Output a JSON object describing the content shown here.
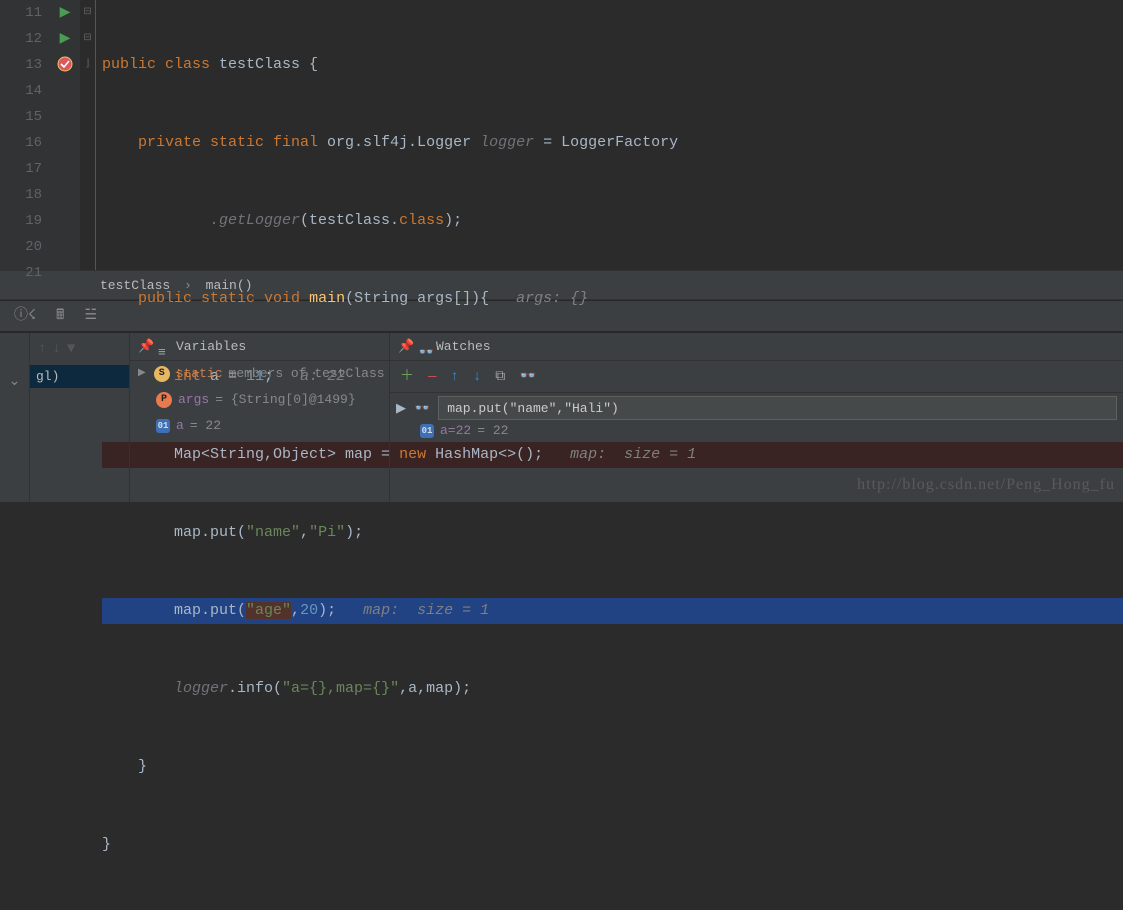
{
  "gutter": [
    "11",
    "12",
    "13",
    "14",
    "15",
    "16",
    "17",
    "18",
    "19",
    "20",
    "21"
  ],
  "code": {
    "l11_kw1": "public ",
    "l11_kw2": "class ",
    "l11_id": "testClass",
    "l11_b": " {",
    "l12_kw": "private static final ",
    "l12_t": "org.slf4j.Logger ",
    "l12_v": "logger",
    "l12_eq": " = ",
    "l12_m": "LoggerFactory",
    "l13_m": ".getLogger",
    "l13_r": "(testClass.",
    "l13_kw": "class",
    "l13_e": ");",
    "l14_kw1": "public static ",
    "l14_kw2": "void ",
    "l14_m": "main",
    "l14_p": "(String args[]){",
    "l14_h": "   args: {}",
    "l15_kw": "int ",
    "l15_v": "a = ",
    "l15_n": "11",
    "l15_s": ";",
    "l15_h": "   a: 22",
    "l16_t": "Map<String,Object> map = ",
    "l16_kw": "new ",
    "l16_c": "HashMap<>()",
    "l16_s": ";",
    "l16_h": "   map:  size = 1",
    "l17_a": "map.put(",
    "l17_s1": "\"name\"",
    "l17_b": ",",
    "l17_s2": "\"Pi\"",
    "l17_c": ");",
    "l18_a": "map.put(",
    "l18_s1": "\"age\"",
    "l18_b": ",",
    "l18_n": "20",
    "l18_c": ");",
    "l18_h": "   map:  size = 1",
    "l19_v": "logger",
    "l19_m": ".info(",
    "l19_s": "\"a={},map={}\"",
    "l19_r": ",a,map);",
    "l20_b": "}",
    "l21_b": "}"
  },
  "breadcrumb": {
    "a": "testClass",
    "b": "main()"
  },
  "variables": {
    "title": "Variables",
    "static_label": "static",
    "static_rest": " members of testClass",
    "args_name": "args",
    "args_val": " = {String[0]@1499}",
    "a_name": "a",
    "a_val": " = 22"
  },
  "watches": {
    "title": "Watches",
    "input": "map.put(\"name\",\"Hali\")",
    "res_label": "a=22",
    "res_val": " = 22"
  },
  "thread": "gl)",
  "watermark": "http://blog.csdn.net/Peng_Hong_fu"
}
